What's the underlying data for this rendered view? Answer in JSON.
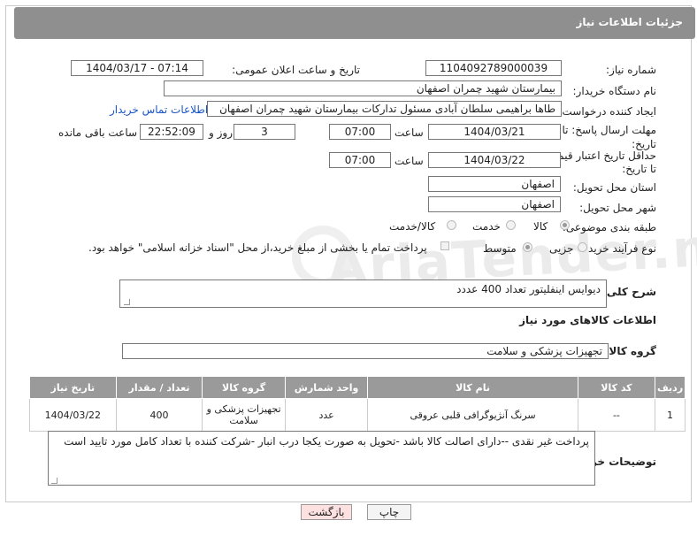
{
  "header": {
    "title": "جزئیات اطلاعات نیاز"
  },
  "fields": {
    "need_number_label": "شماره نیاز:",
    "need_number": "1104092789000039",
    "announce_label": "تاریخ و ساعت اعلان عمومی:",
    "announce_value": "1404/03/17 - 07:14",
    "buyer_org_label": "نام دستگاه خریدار:",
    "buyer_org": "بیمارستان شهید چمران اصفهان",
    "requester_label": "ایجاد کننده درخواست:",
    "requester": "طاها براهیمی سلطان آبادی مسئول تدارکات  بیمارستان شهید چمران اصفهان",
    "contact_link": "اطلاعات تماس خریدار",
    "deadline_label_1": "مهلت ارسال پاسخ: تا",
    "deadline_label_2": "تاریخ:",
    "deadline_date": "1404/03/21",
    "time_label": "ساعت",
    "deadline_time": "07:00",
    "days_value": "3",
    "days_label": "روز و",
    "remaining_time": "22:52:09",
    "remaining_label": "ساعت باقی مانده",
    "validity_label_1": "حداقل تاریخ اعتبار قیمت:",
    "validity_label_2": "تا تاریخ:",
    "validity_date": "1404/03/22",
    "validity_time": "07:00",
    "province_label": "استان محل تحویل:",
    "province": "اصفهان",
    "city_label": "شهر محل تحویل:",
    "city": "اصفهان",
    "category_label": "طبقه بندی موضوعی:",
    "category_options": [
      "کالا",
      "خدمت",
      "کالا/خدمت"
    ],
    "process_label": "نوع فرآیند خرید :",
    "process_options": [
      "جزیی",
      "متوسط"
    ],
    "payment_note": "پرداخت تمام یا بخشی از مبلغ خرید،از محل \"اسناد خزانه اسلامی\" خواهد بود.",
    "summary_label": "شرح کلی نیاز:",
    "summary": "دیوایس اینفلیتور تعداد 400 عددد",
    "goods_info_title": "اطلاعات کالاهای مورد نیاز",
    "goods_group_label": "گروه کالا:",
    "goods_group": "تجهیزات پزشکی و سلامت",
    "buyer_notes_label": "توضیحات خریدار:",
    "buyer_notes": "پرداخت غیر نقدی --دارای اصالت کالا باشد -تحویل به صورت یکجا درب انبار -شرکت کننده با تعداد کامل مورد تایید است"
  },
  "table": {
    "headers": [
      "ردیف",
      "کد کالا",
      "نام کالا",
      "واحد شمارش",
      "گروه کالا",
      "تعداد / مقدار",
      "تاریخ نیاز"
    ],
    "rows": [
      [
        "1",
        "--",
        "سرنگ آنژیوگرافی قلبی عروقی",
        "عدد",
        "تجهیزات پزشکی و سلامت",
        "400",
        "1404/03/22"
      ]
    ]
  },
  "buttons": {
    "print": "چاپ",
    "back": "بازگشت"
  },
  "watermark": "AriaTender.neT"
}
